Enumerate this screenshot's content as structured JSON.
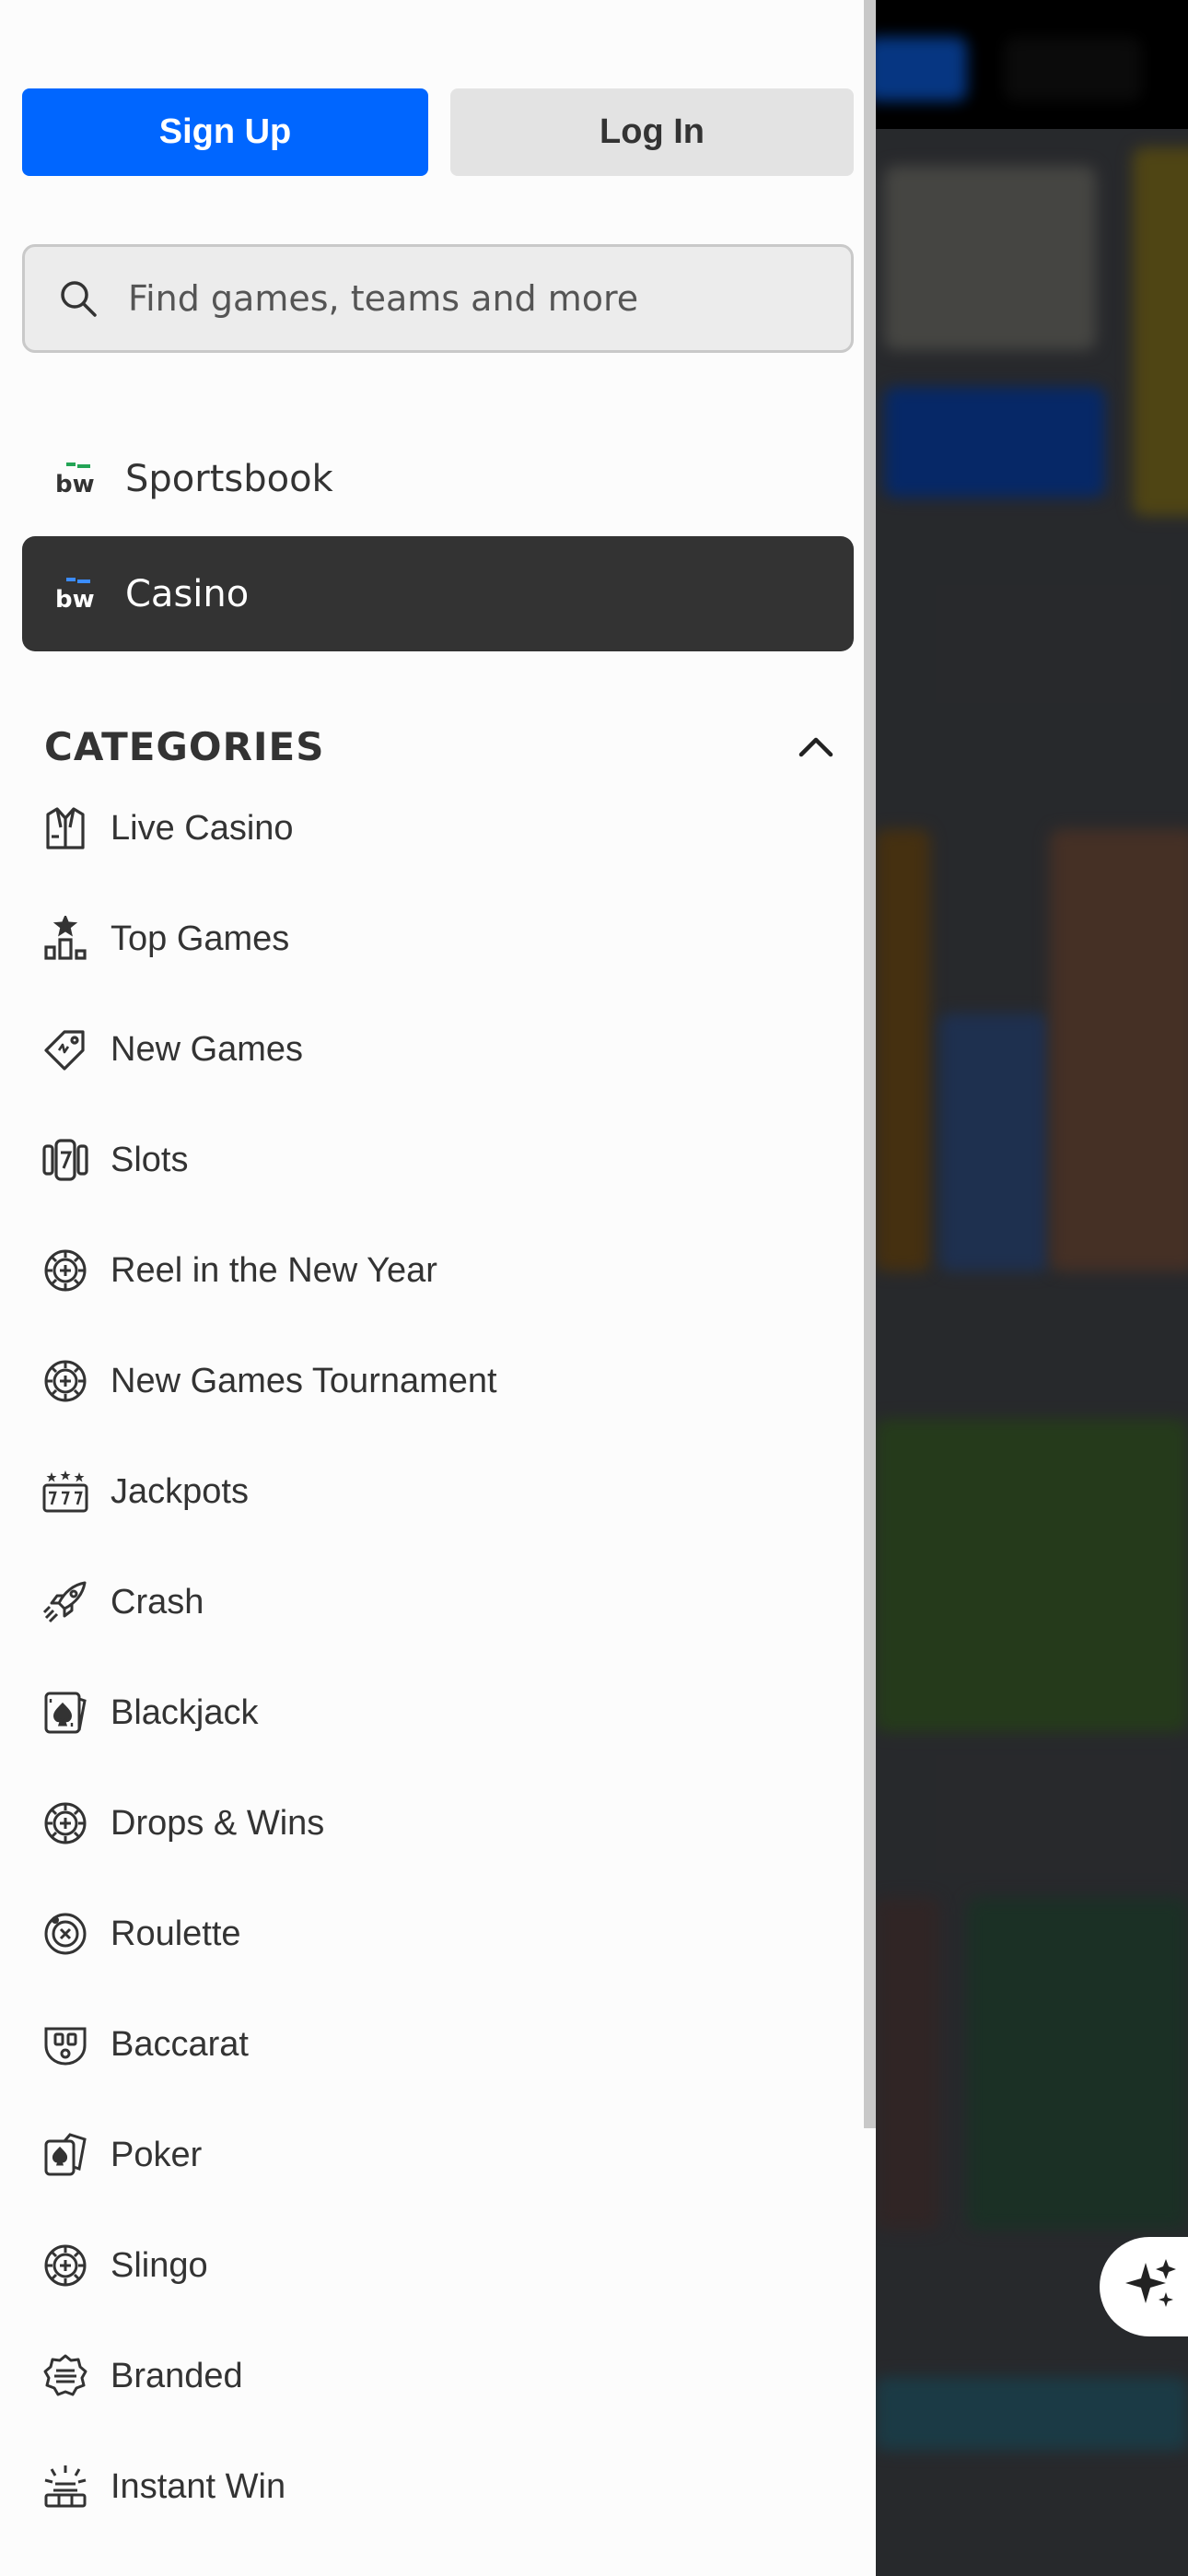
{
  "auth": {
    "signup_label": "Sign Up",
    "login_label": "Log In"
  },
  "search": {
    "placeholder": "Find games, teams and more",
    "icon": "search-icon"
  },
  "nav": [
    {
      "label": "Sportsbook",
      "icon": "bw-logo",
      "active": false
    },
    {
      "label": "Casino",
      "icon": "bw-logo",
      "active": true
    }
  ],
  "categories": {
    "title": "CATEGORIES",
    "items": [
      {
        "label": "Live Casino",
        "icon": "dealer-icon"
      },
      {
        "label": "Top Games",
        "icon": "podium-icon"
      },
      {
        "label": "New Games",
        "icon": "tag-icon"
      },
      {
        "label": "Slots",
        "icon": "slot-reel-icon"
      },
      {
        "label": "Reel in the New Year",
        "icon": "chip-icon"
      },
      {
        "label": "New Games Tournament",
        "icon": "chip-icon"
      },
      {
        "label": "Jackpots",
        "icon": "jackpot-777-icon"
      },
      {
        "label": "Crash",
        "icon": "rocket-icon"
      },
      {
        "label": "Blackjack",
        "icon": "card-spade-icon"
      },
      {
        "label": "Drops & Wins",
        "icon": "chip-icon"
      },
      {
        "label": "Roulette",
        "icon": "roulette-icon"
      },
      {
        "label": "Baccarat",
        "icon": "baccarat-table-icon"
      },
      {
        "label": "Poker",
        "icon": "poker-cards-icon"
      },
      {
        "label": "Slingo",
        "icon": "chip-icon"
      },
      {
        "label": "Branded",
        "icon": "badge-icon"
      },
      {
        "label": "Instant Win",
        "icon": "instant-win-icon"
      }
    ]
  },
  "colors": {
    "primary": "#0066ff",
    "active_nav": "#333333",
    "text": "#333333"
  }
}
